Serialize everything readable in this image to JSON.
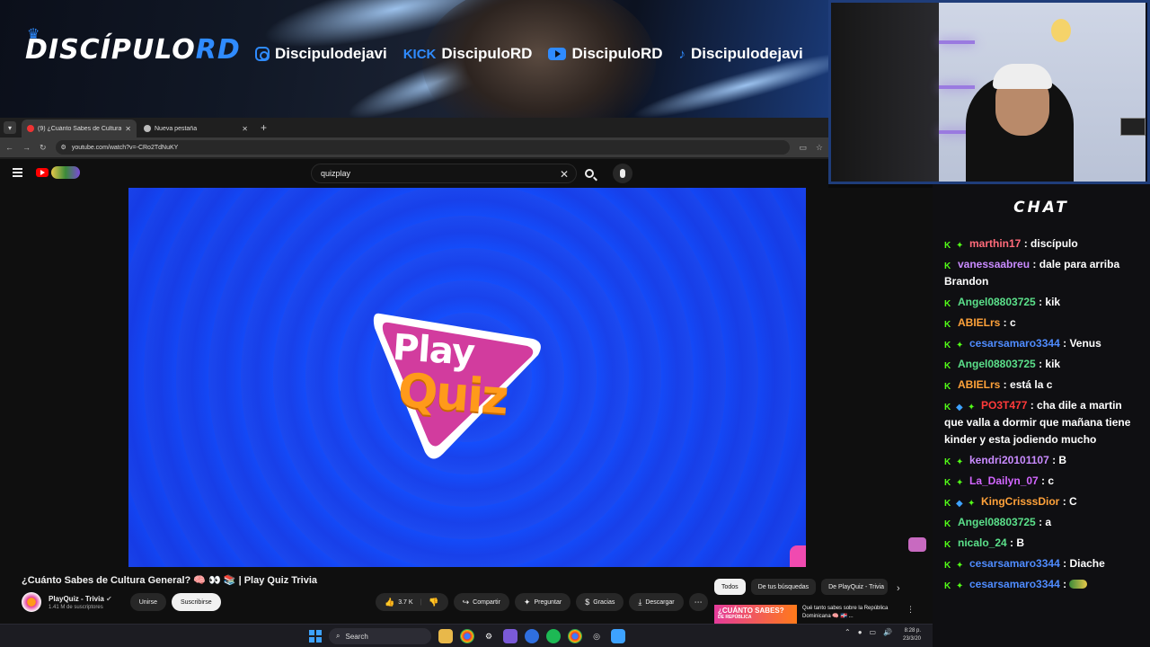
{
  "banner": {
    "logo_main": "DISCÍPULO",
    "logo_accent": "RD",
    "socials": [
      {
        "icon": "instagram-icon",
        "label": "Discipulodejavi"
      },
      {
        "icon": "kick-icon",
        "prefix": "KICK",
        "label": "DiscipuloRD"
      },
      {
        "icon": "youtube-icon",
        "label": "DiscipuloRD"
      },
      {
        "icon": "tiktok-icon",
        "label": "Discipulodejavi"
      }
    ]
  },
  "browser": {
    "tabs": [
      {
        "label": "(9) ¿Cuánto Sabes de Cultura G",
        "active": true
      },
      {
        "label": "Nueva pestaña",
        "active": false
      }
    ],
    "url": "youtube.com/watch?v=-CRo2TdNuKY"
  },
  "youtube": {
    "search_value": "quizplay",
    "video_title": "¿Cuánto Sabes de Cultura General? 🧠 👀 📚 | Play Quiz Trivia",
    "channel_name": "PlayQuiz - Trivia",
    "subscribers": "1.41 M de suscriptores",
    "join_label": "Unirse",
    "subscribe_label": "Suscribirse",
    "likes": "3.7 K",
    "share_label": "Compartir",
    "ask_label": "Preguntar",
    "thanks_label": "Gracias",
    "download_label": "Descargar",
    "chips": [
      "Todos",
      "De tus búsquedas",
      "De PlayQuiz - Trivia"
    ],
    "rec_thumb_text": "¿CUÁNTO SABES?",
    "rec_thumb_sub": "DE REPÚBLICA",
    "rec_title": "Qué tanto sabes sobre la República Dominicana 🧠 🇩🇴 ..."
  },
  "player_logo": {
    "line1": "Play",
    "line2": "Quiz"
  },
  "taskbar": {
    "search_label": "Search",
    "time": "8:28 p.",
    "date": "23/3/20"
  },
  "chat": {
    "title": "CHAT",
    "messages": [
      {
        "badges": "K ✦",
        "user": "marthin17",
        "color": "#ff6b7a",
        "text": "discípulo"
      },
      {
        "badges": "K",
        "user": "vanessaabreu",
        "color": "#c98bff",
        "text": "dale para arriba Brandon"
      },
      {
        "badges": "K",
        "user": "Angel08803725",
        "color": "#5be08a",
        "text": "kik"
      },
      {
        "badges": "K",
        "user": "ABIELrs",
        "color": "#ffa23a",
        "text": "c"
      },
      {
        "badges": "K ✦",
        "user": "cesarsamaro3344",
        "color": "#4f8cff",
        "text": "Venus"
      },
      {
        "badges": "K",
        "user": "Angel08803725",
        "color": "#5be08a",
        "text": "kik"
      },
      {
        "badges": "K",
        "user": "ABIELrs",
        "color": "#ffa23a",
        "text": "está la c"
      },
      {
        "badges": "K ◆ ✦",
        "user": "PO3T477",
        "color": "#ff3a3a",
        "text": "cha dile a martin que valla a dormir que mañana tiene kinder y esta jodiendo mucho"
      },
      {
        "badges": "K ✦",
        "user": "kendri20101107",
        "color": "#c98bff",
        "text": "B"
      },
      {
        "badges": "K ✦",
        "user": "La_Dailyn_07",
        "color": "#d266ff",
        "text": "c"
      },
      {
        "badges": "K ◆ ✦",
        "user": "KingCrisssDior",
        "color": "#ffa23a",
        "text": "C"
      },
      {
        "badges": "K",
        "user": "Angel08803725",
        "color": "#5be08a",
        "text": "a"
      },
      {
        "badges": "K",
        "user": "nicalo_24",
        "color": "#5be08a",
        "text": "B"
      },
      {
        "badges": "K ✦",
        "user": "cesarsamaro3344",
        "color": "#4f8cff",
        "text": "Diache"
      },
      {
        "badges": "K ✦",
        "user": "cesarsamaro3344",
        "color": "#4f8cff",
        "text": ""
      }
    ]
  }
}
